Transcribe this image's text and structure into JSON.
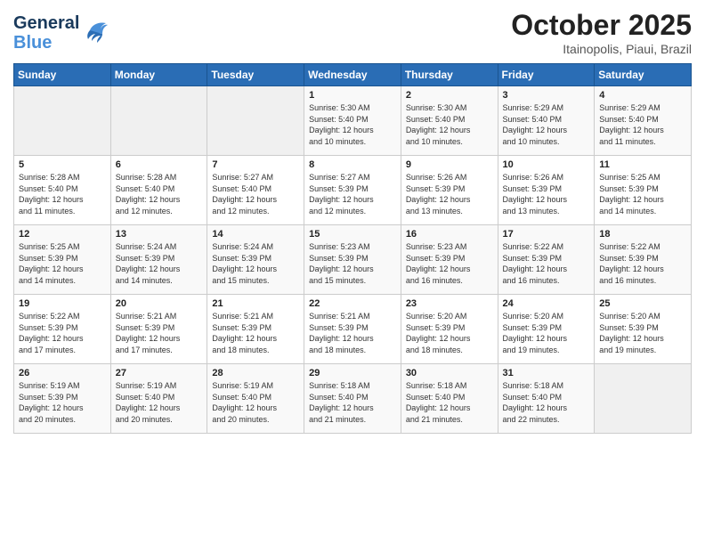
{
  "header": {
    "logo_line1": "General",
    "logo_line2": "Blue",
    "month": "October 2025",
    "location": "Itainopolis, Piaui, Brazil"
  },
  "weekdays": [
    "Sunday",
    "Monday",
    "Tuesday",
    "Wednesday",
    "Thursday",
    "Friday",
    "Saturday"
  ],
  "weeks": [
    [
      {
        "day": "",
        "info": ""
      },
      {
        "day": "",
        "info": ""
      },
      {
        "day": "",
        "info": ""
      },
      {
        "day": "1",
        "info": "Sunrise: 5:30 AM\nSunset: 5:40 PM\nDaylight: 12 hours\nand 10 minutes."
      },
      {
        "day": "2",
        "info": "Sunrise: 5:30 AM\nSunset: 5:40 PM\nDaylight: 12 hours\nand 10 minutes."
      },
      {
        "day": "3",
        "info": "Sunrise: 5:29 AM\nSunset: 5:40 PM\nDaylight: 12 hours\nand 10 minutes."
      },
      {
        "day": "4",
        "info": "Sunrise: 5:29 AM\nSunset: 5:40 PM\nDaylight: 12 hours\nand 11 minutes."
      }
    ],
    [
      {
        "day": "5",
        "info": "Sunrise: 5:28 AM\nSunset: 5:40 PM\nDaylight: 12 hours\nand 11 minutes."
      },
      {
        "day": "6",
        "info": "Sunrise: 5:28 AM\nSunset: 5:40 PM\nDaylight: 12 hours\nand 12 minutes."
      },
      {
        "day": "7",
        "info": "Sunrise: 5:27 AM\nSunset: 5:40 PM\nDaylight: 12 hours\nand 12 minutes."
      },
      {
        "day": "8",
        "info": "Sunrise: 5:27 AM\nSunset: 5:39 PM\nDaylight: 12 hours\nand 12 minutes."
      },
      {
        "day": "9",
        "info": "Sunrise: 5:26 AM\nSunset: 5:39 PM\nDaylight: 12 hours\nand 13 minutes."
      },
      {
        "day": "10",
        "info": "Sunrise: 5:26 AM\nSunset: 5:39 PM\nDaylight: 12 hours\nand 13 minutes."
      },
      {
        "day": "11",
        "info": "Sunrise: 5:25 AM\nSunset: 5:39 PM\nDaylight: 12 hours\nand 14 minutes."
      }
    ],
    [
      {
        "day": "12",
        "info": "Sunrise: 5:25 AM\nSunset: 5:39 PM\nDaylight: 12 hours\nand 14 minutes."
      },
      {
        "day": "13",
        "info": "Sunrise: 5:24 AM\nSunset: 5:39 PM\nDaylight: 12 hours\nand 14 minutes."
      },
      {
        "day": "14",
        "info": "Sunrise: 5:24 AM\nSunset: 5:39 PM\nDaylight: 12 hours\nand 15 minutes."
      },
      {
        "day": "15",
        "info": "Sunrise: 5:23 AM\nSunset: 5:39 PM\nDaylight: 12 hours\nand 15 minutes."
      },
      {
        "day": "16",
        "info": "Sunrise: 5:23 AM\nSunset: 5:39 PM\nDaylight: 12 hours\nand 16 minutes."
      },
      {
        "day": "17",
        "info": "Sunrise: 5:22 AM\nSunset: 5:39 PM\nDaylight: 12 hours\nand 16 minutes."
      },
      {
        "day": "18",
        "info": "Sunrise: 5:22 AM\nSunset: 5:39 PM\nDaylight: 12 hours\nand 16 minutes."
      }
    ],
    [
      {
        "day": "19",
        "info": "Sunrise: 5:22 AM\nSunset: 5:39 PM\nDaylight: 12 hours\nand 17 minutes."
      },
      {
        "day": "20",
        "info": "Sunrise: 5:21 AM\nSunset: 5:39 PM\nDaylight: 12 hours\nand 17 minutes."
      },
      {
        "day": "21",
        "info": "Sunrise: 5:21 AM\nSunset: 5:39 PM\nDaylight: 12 hours\nand 18 minutes."
      },
      {
        "day": "22",
        "info": "Sunrise: 5:21 AM\nSunset: 5:39 PM\nDaylight: 12 hours\nand 18 minutes."
      },
      {
        "day": "23",
        "info": "Sunrise: 5:20 AM\nSunset: 5:39 PM\nDaylight: 12 hours\nand 18 minutes."
      },
      {
        "day": "24",
        "info": "Sunrise: 5:20 AM\nSunset: 5:39 PM\nDaylight: 12 hours\nand 19 minutes."
      },
      {
        "day": "25",
        "info": "Sunrise: 5:20 AM\nSunset: 5:39 PM\nDaylight: 12 hours\nand 19 minutes."
      }
    ],
    [
      {
        "day": "26",
        "info": "Sunrise: 5:19 AM\nSunset: 5:39 PM\nDaylight: 12 hours\nand 20 minutes."
      },
      {
        "day": "27",
        "info": "Sunrise: 5:19 AM\nSunset: 5:40 PM\nDaylight: 12 hours\nand 20 minutes."
      },
      {
        "day": "28",
        "info": "Sunrise: 5:19 AM\nSunset: 5:40 PM\nDaylight: 12 hours\nand 20 minutes."
      },
      {
        "day": "29",
        "info": "Sunrise: 5:18 AM\nSunset: 5:40 PM\nDaylight: 12 hours\nand 21 minutes."
      },
      {
        "day": "30",
        "info": "Sunrise: 5:18 AM\nSunset: 5:40 PM\nDaylight: 12 hours\nand 21 minutes."
      },
      {
        "day": "31",
        "info": "Sunrise: 5:18 AM\nSunset: 5:40 PM\nDaylight: 12 hours\nand 22 minutes."
      },
      {
        "day": "",
        "info": ""
      }
    ]
  ]
}
